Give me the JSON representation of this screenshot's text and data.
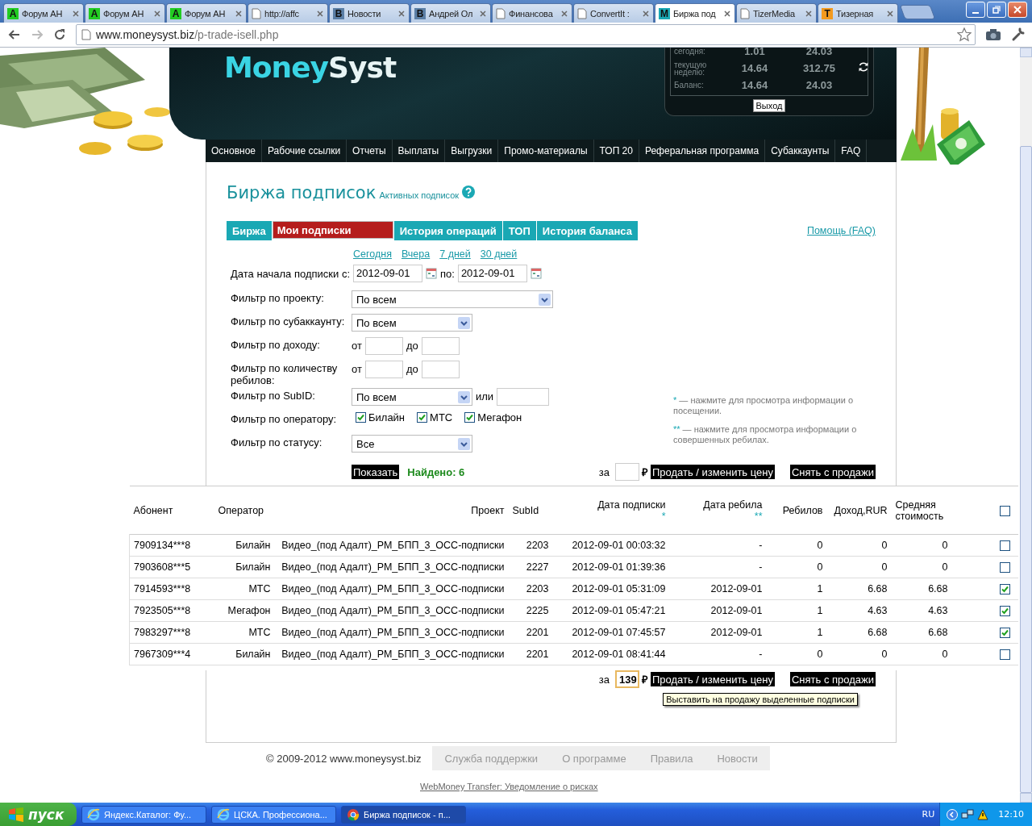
{
  "browser": {
    "tabs": [
      {
        "title": "Форум АН",
        "icon": {
          "kind": "letter",
          "letter": "A",
          "color": "#22cc22"
        },
        "selected": false
      },
      {
        "title": "Форум АН",
        "icon": {
          "kind": "letter",
          "letter": "A",
          "color": "#22cc22"
        },
        "selected": false
      },
      {
        "title": "Форум АН",
        "icon": {
          "kind": "letter",
          "letter": "A",
          "color": "#22cc22"
        },
        "selected": false
      },
      {
        "title": "http://affc",
        "icon": {
          "kind": "page"
        },
        "selected": false
      },
      {
        "title": "Новости",
        "icon": {
          "kind": "letter",
          "letter": "В",
          "color": "#5b7fa6"
        },
        "selected": false
      },
      {
        "title": "Андрей Ол",
        "icon": {
          "kind": "letter",
          "letter": "В",
          "color": "#5b7fa6"
        },
        "selected": false
      },
      {
        "title": "Финансова",
        "icon": {
          "kind": "page"
        },
        "selected": false
      },
      {
        "title": "ConvertIt :",
        "icon": {
          "kind": "page"
        },
        "selected": false
      },
      {
        "title": "Биржа под",
        "icon": {
          "kind": "letter",
          "letter": "M",
          "color": "#1aa8b4"
        },
        "selected": true
      },
      {
        "title": "TizerMedia",
        "icon": {
          "kind": "page"
        },
        "selected": false
      },
      {
        "title": "Тизерная",
        "icon": {
          "kind": "letter",
          "letter": "T",
          "color": "#f39a1e"
        },
        "selected": false
      }
    ],
    "address": {
      "host": "www.moneysyst.biz",
      "path": "/p-trade-isell.php"
    }
  },
  "header": {
    "logo_a": "Money",
    "logo_b": "Syst",
    "stats": [
      {
        "label": "сегодня:",
        "value_1": "1.01",
        "value_2": "24.03"
      },
      {
        "label": "текущую неделю:",
        "value_1": "14.64",
        "value_2": "312.75"
      },
      {
        "label": "Баланс:",
        "value_1": "14.64",
        "value_2": "24.03"
      }
    ],
    "logout": "Выход"
  },
  "nav": [
    "Основное",
    "Рабочие ссылки",
    "Отчеты",
    "Выплаты",
    "Выгрузки",
    "Промо-материалы",
    "ТОП 20",
    "Реферальная программа",
    "Субаккаунты",
    "FAQ"
  ],
  "page": {
    "title": "Биржа подписок",
    "subtitle": "Активных подписок",
    "tabs": [
      {
        "label": "Биржа",
        "selected": false
      },
      {
        "label": "Мои подписки",
        "selected": true
      },
      {
        "label": "История операций",
        "selected": false
      },
      {
        "label": "ТОП",
        "selected": false
      },
      {
        "label": "История баланса",
        "selected": false
      }
    ],
    "help_link": "Помощь (FAQ)",
    "quick_dates": [
      "Сегодня",
      "Вчера",
      "7 дней",
      "30 дней"
    ],
    "date_range": {
      "label": "Дата начала подписки с:",
      "from": "2012-09-01",
      "to_label": "по:",
      "to": "2012-09-01"
    },
    "filters": [
      {
        "kind": "select-wide",
        "label": "Фильтр по проекту:",
        "value": "По всем"
      },
      {
        "kind": "select",
        "label": "Фильтр по субаккаунту:",
        "value": "По всем"
      },
      {
        "kind": "range",
        "label": "Фильтр по доходу:",
        "from_label": "от",
        "to_label": "до"
      },
      {
        "kind": "range",
        "label": "Фильтр по количеству ребилов:",
        "from_label": "от",
        "to_label": "до"
      },
      {
        "kind": "select-or",
        "label": "Фильтр по SubID:",
        "value": "По всем",
        "or_label": "или"
      },
      {
        "kind": "checks",
        "label": "Фильтр по оператору:",
        "options": [
          {
            "label": "Билайн",
            "checked": true
          },
          {
            "label": "МТС",
            "checked": true
          },
          {
            "label": "Мегафон",
            "checked": true
          }
        ]
      },
      {
        "kind": "select",
        "label": "Фильтр по статусу:",
        "value": "Все"
      }
    ],
    "notes": [
      {
        "mark": "*",
        "text": "— нажмите для просмотра информации о посещении."
      },
      {
        "mark": "**",
        "text": "— нажмите для просмотра информации о совершенных ребилах."
      }
    ],
    "show_button": "Показать",
    "found": "Найдено: 6",
    "sell_top": {
      "za": "за",
      "currency": "₽",
      "sell": "Продать / изменить цену",
      "remove": "Снять с продажи"
    },
    "table": {
      "columns": [
        {
          "label": "Абонент"
        },
        {
          "label": "Оператор"
        },
        {
          "label": "Проект"
        },
        {
          "label": "SubId"
        },
        {
          "label": "Дата подписки",
          "note": "*"
        },
        {
          "label": "Дата ребила",
          "note": "**"
        },
        {
          "label": "Ребилов"
        },
        {
          "label": "Доход,RUR"
        },
        {
          "label": "Средняя стоимость"
        }
      ],
      "all_checked": false,
      "rows": [
        {
          "cells": [
            "7909134***8",
            "Билайн",
            "Видео_(под Адалт)_РМ_БПП_3_ОСС-подписки",
            "2203",
            "2012-09-01 00:03:32",
            "-",
            "0",
            "0",
            "0"
          ],
          "checked": false
        },
        {
          "cells": [
            "7903608***5",
            "Билайн",
            "Видео_(под Адалт)_РМ_БПП_3_ОСС-подписки",
            "2227",
            "2012-09-01 01:39:36",
            "-",
            "0",
            "0",
            "0"
          ],
          "checked": false
        },
        {
          "cells": [
            "7914593***8",
            "МТС",
            "Видео_(под Адалт)_РМ_БПП_3_ОСС-подписки",
            "2203",
            "2012-09-01 05:31:09",
            "2012-09-01",
            "1",
            "6.68",
            "6.68"
          ],
          "checked": true
        },
        {
          "cells": [
            "7923505***8",
            "Мегафон",
            "Видео_(под Адалт)_РМ_БПП_3_ОСС-подписки",
            "2225",
            "2012-09-01 05:47:21",
            "2012-09-01",
            "1",
            "4.63",
            "4.63"
          ],
          "checked": true
        },
        {
          "cells": [
            "7983297***8",
            "МТС",
            "Видео_(под Адалт)_РМ_БПП_3_ОСС-подписки",
            "2201",
            "2012-09-01 07:45:57",
            "2012-09-01",
            "1",
            "6.68",
            "6.68"
          ],
          "checked": true
        },
        {
          "cells": [
            "7967309***4",
            "Билайн",
            "Видео_(под Адалт)_РМ_БПП_3_ОСС-подписки",
            "2201",
            "2012-09-01 08:41:44",
            "-",
            "0",
            "0",
            "0"
          ],
          "checked": false
        }
      ]
    },
    "sell_bottom": {
      "za": "за",
      "price": "139",
      "currency": "₽",
      "sell": "Продать / изменить цену",
      "remove": "Снять с продажи",
      "tooltip": "Выставить на продажу выделенные подписки"
    }
  },
  "footer": {
    "copyright": "© 2009-2012 www.moneysyst.biz",
    "links": [
      "Служба поддержки",
      "О программе",
      "Правила",
      "Новости"
    ],
    "notice": "WebMoney Transfer: Уведомление о рисках"
  },
  "taskbar": {
    "start": "пуск",
    "tasks": [
      {
        "title": "Яндекс.Каталог: Фу...",
        "kind": "ie",
        "selected": false
      },
      {
        "title": "ЦСКА. Профессиона...",
        "kind": "ie",
        "selected": false
      },
      {
        "title": "Биржа подписок - п...",
        "kind": "chrome",
        "selected": true
      }
    ],
    "lang": "RU",
    "time": "12:10"
  }
}
